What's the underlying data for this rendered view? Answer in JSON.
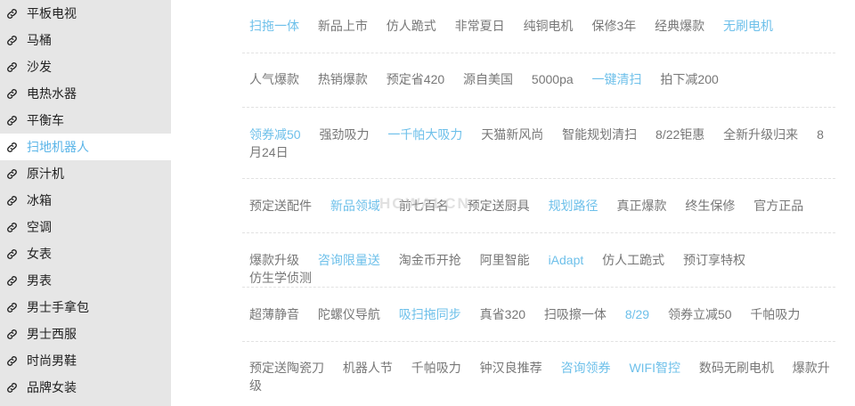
{
  "sidebar": {
    "items": [
      {
        "label": "平板电视",
        "active": false
      },
      {
        "label": "马桶",
        "active": false
      },
      {
        "label": "沙发",
        "active": false
      },
      {
        "label": "电热水器",
        "active": false
      },
      {
        "label": "平衡车",
        "active": false
      },
      {
        "label": "扫地机器人",
        "active": true
      },
      {
        "label": "原汁机",
        "active": false
      },
      {
        "label": "冰箱",
        "active": false
      },
      {
        "label": "空调",
        "active": false
      },
      {
        "label": "女表",
        "active": false
      },
      {
        "label": "男表",
        "active": false
      },
      {
        "label": "男士手拿包",
        "active": false
      },
      {
        "label": "男士西服",
        "active": false
      },
      {
        "label": "时尚男鞋",
        "active": false
      },
      {
        "label": "品牌女装",
        "active": false
      }
    ]
  },
  "tag_rows": [
    [
      {
        "text": "扫拖一体",
        "highlight": true
      },
      {
        "text": "新品上市",
        "highlight": false
      },
      {
        "text": "仿人跪式",
        "highlight": false
      },
      {
        "text": "非常夏日",
        "highlight": false
      },
      {
        "text": "纯铜电机",
        "highlight": false
      },
      {
        "text": "保修3年",
        "highlight": false
      },
      {
        "text": "经典爆款",
        "highlight": false
      },
      {
        "text": "无刷电机",
        "highlight": true
      }
    ],
    [
      {
        "text": "人气爆款",
        "highlight": false
      },
      {
        "text": "热销爆款",
        "highlight": false
      },
      {
        "text": "预定省420",
        "highlight": false
      },
      {
        "text": "源自美国",
        "highlight": false
      },
      {
        "text": "5000pa",
        "highlight": false
      },
      {
        "text": "一键清扫",
        "highlight": true
      },
      {
        "text": "拍下减200",
        "highlight": false
      }
    ],
    [
      {
        "text": "领券减50",
        "highlight": true
      },
      {
        "text": "强劲吸力",
        "highlight": false
      },
      {
        "text": "一千帕大吸力",
        "highlight": true
      },
      {
        "text": "天猫新风尚",
        "highlight": false
      },
      {
        "text": "智能规划清扫",
        "highlight": false
      },
      {
        "text": "8/22钜惠",
        "highlight": false
      },
      {
        "text": "全新升级归来",
        "highlight": false
      },
      {
        "text": "8月24日",
        "highlight": false,
        "wrap": true
      }
    ],
    [
      {
        "text": "预定送配件",
        "highlight": false
      },
      {
        "text": "新品领域",
        "highlight": true
      },
      {
        "text": "前七百名",
        "highlight": false
      },
      {
        "text": "预定送厨具",
        "highlight": false
      },
      {
        "text": "规划路径",
        "highlight": true
      },
      {
        "text": "真正爆款",
        "highlight": false
      },
      {
        "text": "终生保修",
        "highlight": false
      },
      {
        "text": "官方正品",
        "highlight": false
      }
    ],
    [
      {
        "text": "爆款升级",
        "highlight": false
      },
      {
        "text": "咨询限量送",
        "highlight": true
      },
      {
        "text": "淘金币开抢",
        "highlight": false
      },
      {
        "text": "阿里智能",
        "highlight": false
      },
      {
        "text": "iAdapt",
        "highlight": true
      },
      {
        "text": "仿人工跪式",
        "highlight": false
      },
      {
        "text": "预订享特权",
        "highlight": false
      },
      {
        "text": "仿生学侦测",
        "highlight": false
      }
    ],
    [
      {
        "text": "超薄静音",
        "highlight": false
      },
      {
        "text": "陀螺仪导航",
        "highlight": false
      },
      {
        "text": "吸扫拖同步",
        "highlight": true
      },
      {
        "text": "真省320",
        "highlight": false
      },
      {
        "text": "扫吸擦一体",
        "highlight": false
      },
      {
        "text": "8/29",
        "highlight": true
      },
      {
        "text": "领券立减50",
        "highlight": false
      },
      {
        "text": "千帕吸力",
        "highlight": false
      }
    ],
    [
      {
        "text": "预定送陶瓷刀",
        "highlight": false
      },
      {
        "text": "机器人节",
        "highlight": false
      },
      {
        "text": "千帕吸力",
        "highlight": false
      },
      {
        "text": "钟汉良推荐",
        "highlight": false
      },
      {
        "text": "咨询领券",
        "highlight": true
      },
      {
        "text": "WIFI智控",
        "highlight": true
      },
      {
        "text": "数码无刷电机",
        "highlight": false
      },
      {
        "text": "爆款升级",
        "highlight": false,
        "wrap": true
      }
    ]
  ],
  "watermark": "HOWALCN",
  "colors": {
    "highlight": "#6ec0ea",
    "normal": "#777777",
    "sidebar_bg": "#e6e6e6"
  },
  "icon": "link-icon"
}
